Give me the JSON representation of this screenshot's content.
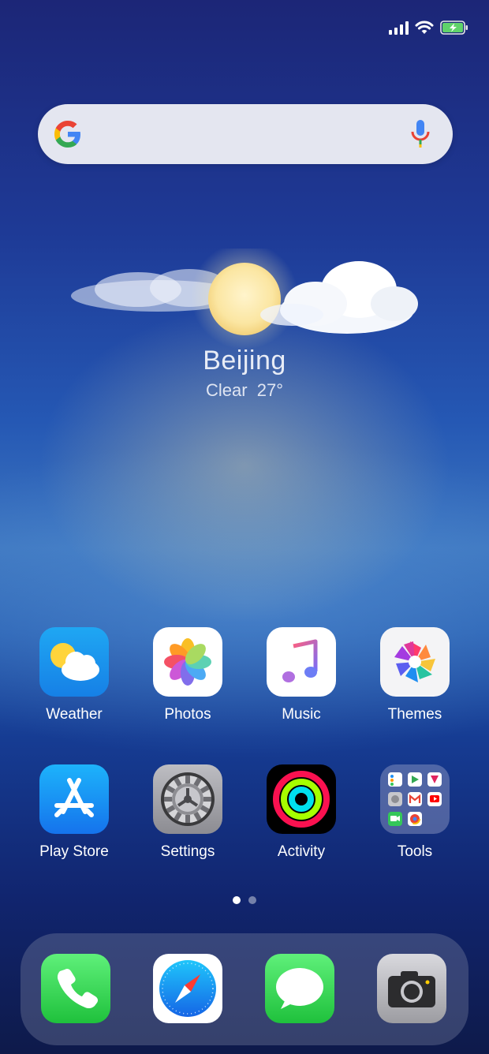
{
  "status_bar": {
    "icons": [
      "signal-icon",
      "wifi-icon",
      "battery-charging-icon"
    ]
  },
  "search": {
    "icons": [
      "google-g-icon",
      "mic-icon"
    ]
  },
  "weather_widget": {
    "city": "Beijing",
    "condition": "Clear",
    "temperature": "27°",
    "icon": "sun-cloud-icon"
  },
  "apps": [
    {
      "label": "Weather",
      "icon": "weather-icon"
    },
    {
      "label": "Photos",
      "icon": "photos-icon"
    },
    {
      "label": "Music",
      "icon": "music-icon"
    },
    {
      "label": "Themes",
      "icon": "themes-icon"
    },
    {
      "label": "Play Store",
      "icon": "app-store-icon"
    },
    {
      "label": "Settings",
      "icon": "gear-icon"
    },
    {
      "label": "Activity",
      "icon": "activity-rings-icon"
    },
    {
      "label": "Tools",
      "icon": "folder-icon"
    }
  ],
  "page_indicator": {
    "pages": 2,
    "current": 1
  },
  "dock": [
    {
      "icon": "phone-icon"
    },
    {
      "icon": "safari-compass-icon"
    },
    {
      "icon": "messages-icon"
    },
    {
      "icon": "camera-icon"
    }
  ],
  "colors": {
    "phone_green": "#3ad24a",
    "settings_gray": "#8e8e93",
    "accent_blue": "#1f8ef1"
  }
}
